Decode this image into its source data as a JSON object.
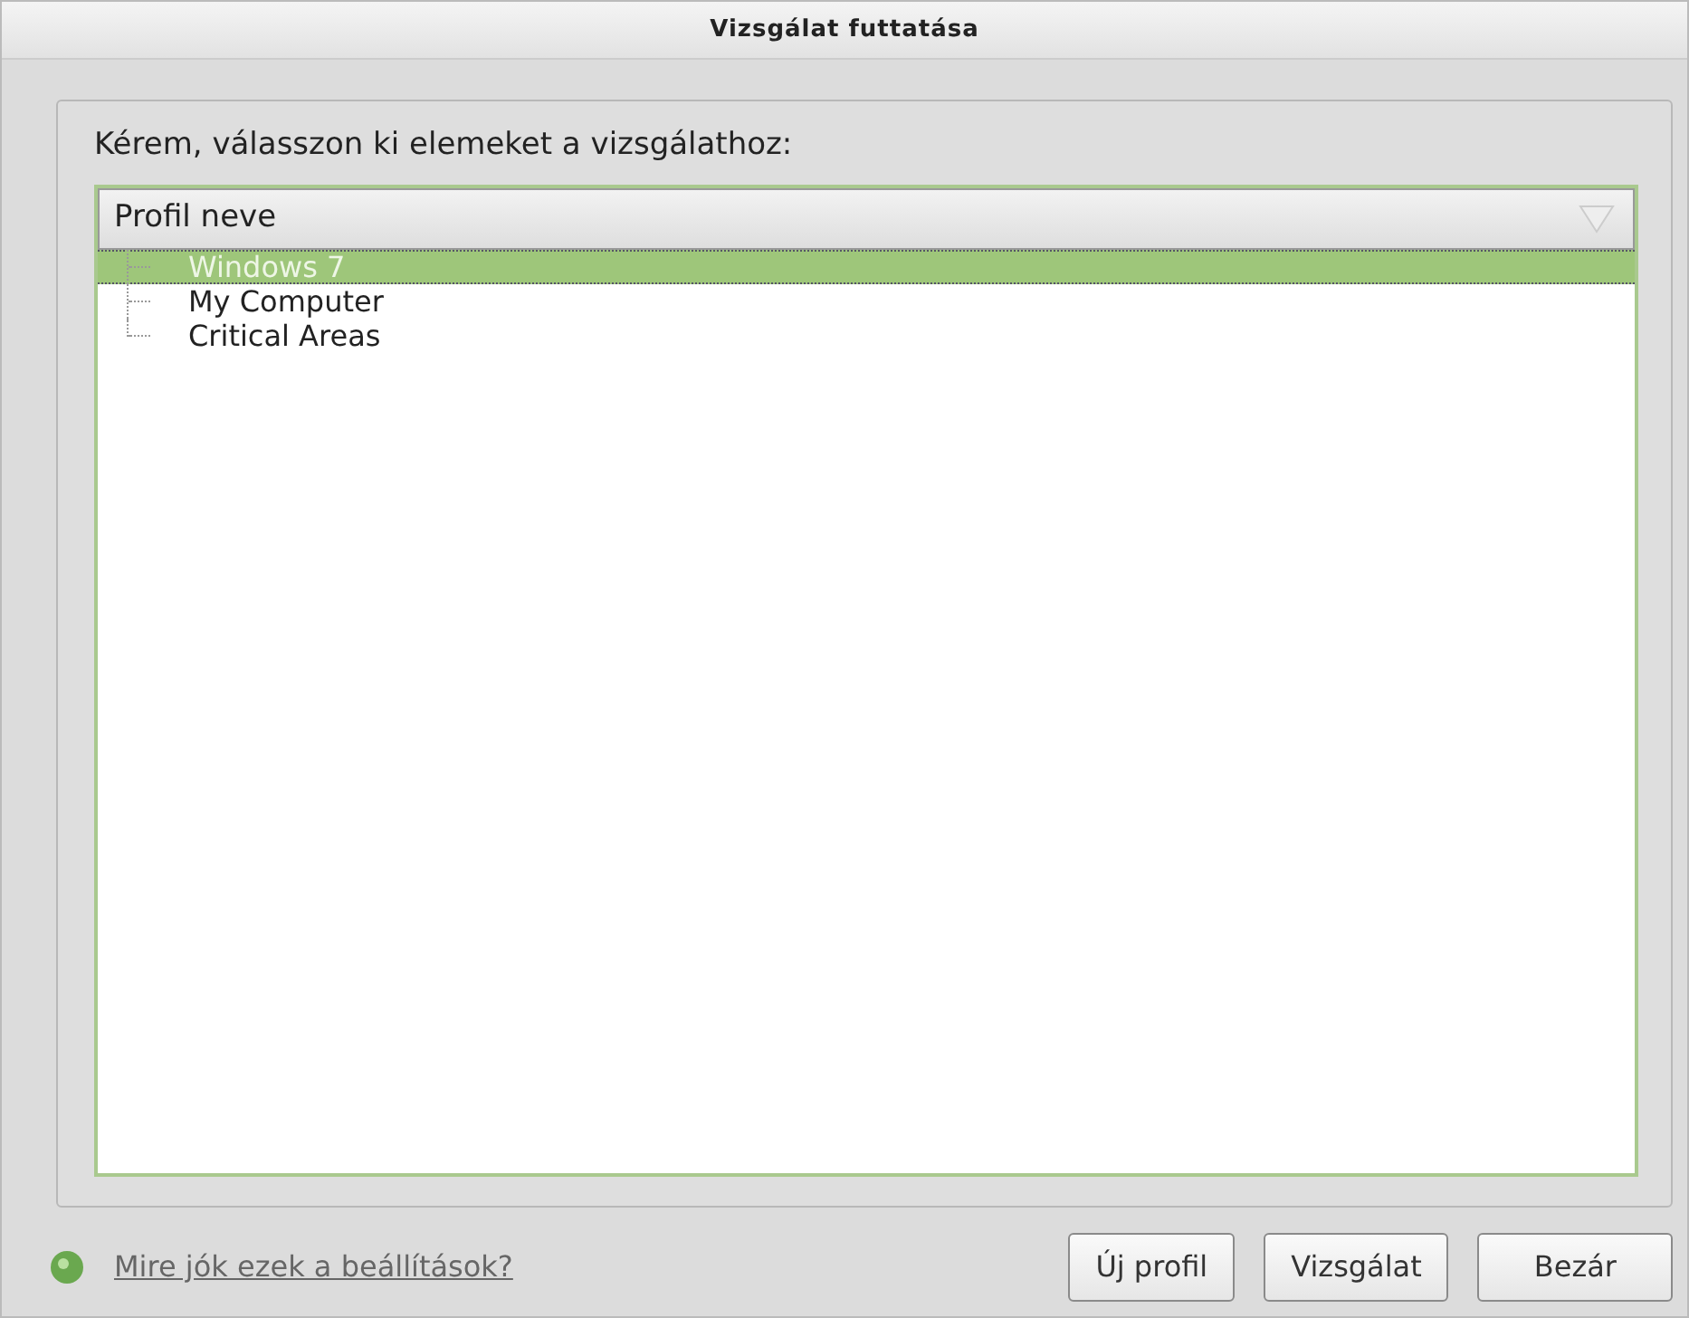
{
  "window": {
    "title": "Vizsgálat futtatása"
  },
  "prompt": "Kérem, válasszon ki elemeket a vizsgálathoz:",
  "tree": {
    "column": "Profil neve",
    "items": [
      {
        "label": "Windows 7",
        "selected": true
      },
      {
        "label": "My Computer",
        "selected": false
      },
      {
        "label": "Critical Areas",
        "selected": false
      }
    ]
  },
  "help_link": "Mire jók ezek a beállítások?",
  "buttons": [
    "Új profil",
    "Vizsgálat",
    "Bezár"
  ]
}
